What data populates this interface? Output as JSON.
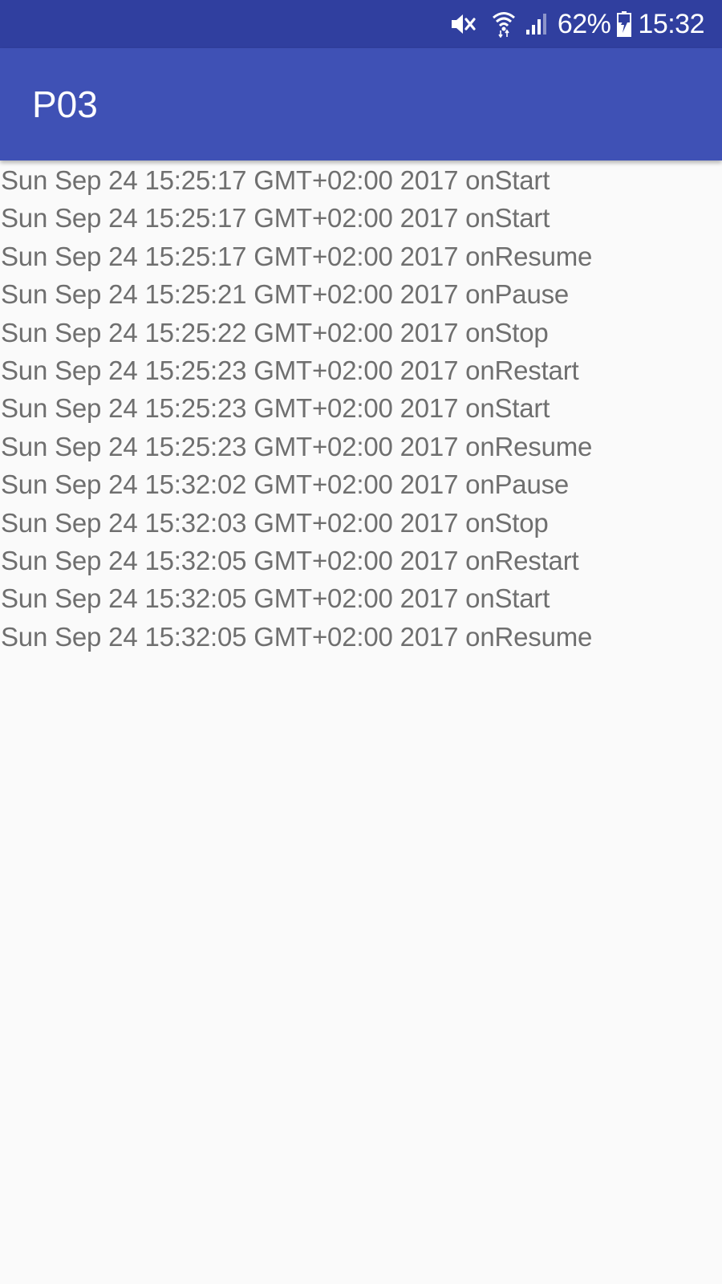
{
  "status_bar": {
    "icons": [
      "mute-icon",
      "wifi-icon",
      "signal-icon",
      "battery-icon"
    ],
    "battery_percent": "62%",
    "time": "15:32",
    "background_color": "#303f9f"
  },
  "app_bar": {
    "title": "P03",
    "background_color": "#3f51b5"
  },
  "log": {
    "lines": [
      "Sun Sep 24 15:25:17 GMT+02:00 2017 onStart",
      "Sun Sep 24 15:25:17 GMT+02:00 2017 onStart",
      "Sun Sep 24 15:25:17 GMT+02:00 2017 onResume",
      "Sun Sep 24 15:25:21 GMT+02:00 2017 onPause",
      "Sun Sep 24 15:25:22 GMT+02:00 2017 onStop",
      "Sun Sep 24 15:25:23 GMT+02:00 2017 onRestart",
      "Sun Sep 24 15:25:23 GMT+02:00 2017 onStart",
      "Sun Sep 24 15:25:23 GMT+02:00 2017 onResume",
      "Sun Sep 24 15:32:02 GMT+02:00 2017 onPause",
      "Sun Sep 24 15:32:03 GMT+02:00 2017 onStop",
      "Sun Sep 24 15:32:05 GMT+02:00 2017 onRestart",
      "Sun Sep 24 15:32:05 GMT+02:00 2017 onStart",
      "Sun Sep 24 15:32:05 GMT+02:00 2017 onResume"
    ]
  }
}
